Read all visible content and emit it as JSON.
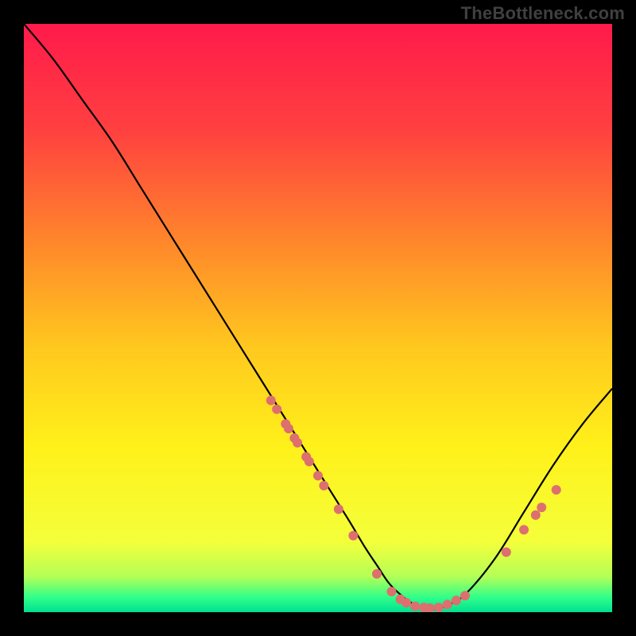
{
  "watermark": "TheBottleneck.com",
  "chart_data": {
    "type": "line",
    "title": "",
    "xlabel": "",
    "ylabel": "",
    "xlim": [
      0,
      100
    ],
    "ylim": [
      0,
      100
    ],
    "grid": false,
    "legend": false,
    "background_gradient_stops": [
      {
        "offset": 0.0,
        "color": "#ff1a4b"
      },
      {
        "offset": 0.18,
        "color": "#ff4040"
      },
      {
        "offset": 0.38,
        "color": "#ff8a2a"
      },
      {
        "offset": 0.55,
        "color": "#ffc81e"
      },
      {
        "offset": 0.72,
        "color": "#fff11a"
      },
      {
        "offset": 0.88,
        "color": "#f4ff3a"
      },
      {
        "offset": 0.94,
        "color": "#b3ff57"
      },
      {
        "offset": 0.975,
        "color": "#2fff8a"
      },
      {
        "offset": 1.0,
        "color": "#00e090"
      }
    ],
    "series": [
      {
        "name": "bottleneck-curve",
        "x": [
          0,
          5,
          10,
          15,
          20,
          25,
          30,
          35,
          40,
          45,
          50,
          55,
          58,
          60,
          62,
          64,
          66,
          68,
          70,
          72,
          75,
          80,
          85,
          90,
          95,
          100
        ],
        "y": [
          100,
          94,
          87,
          80,
          72,
          64,
          56,
          48,
          40,
          32,
          24,
          16,
          11,
          8,
          5,
          3,
          1.5,
          0.8,
          0.5,
          1.2,
          3,
          9,
          17,
          25,
          32,
          38
        ]
      }
    ],
    "markers": {
      "name": "dots",
      "type": "scatter",
      "color": "#dd6f6f",
      "radius": 6,
      "points": [
        {
          "x": 42,
          "y": 36
        },
        {
          "x": 43,
          "y": 34.5
        },
        {
          "x": 44.5,
          "y": 32
        },
        {
          "x": 45,
          "y": 31.2
        },
        {
          "x": 46,
          "y": 29.6
        },
        {
          "x": 46.5,
          "y": 28.8
        },
        {
          "x": 48,
          "y": 26.4
        },
        {
          "x": 48.5,
          "y": 25.6
        },
        {
          "x": 50,
          "y": 23.2
        },
        {
          "x": 51,
          "y": 21.5
        },
        {
          "x": 53.5,
          "y": 17.5
        },
        {
          "x": 56,
          "y": 13
        },
        {
          "x": 60,
          "y": 6.5
        },
        {
          "x": 62.5,
          "y": 3.5
        },
        {
          "x": 64,
          "y": 2.2
        },
        {
          "x": 65,
          "y": 1.6
        },
        {
          "x": 66.5,
          "y": 1.0
        },
        {
          "x": 68,
          "y": 0.8
        },
        {
          "x": 69,
          "y": 0.7
        },
        {
          "x": 70.5,
          "y": 0.8
        },
        {
          "x": 72,
          "y": 1.3
        },
        {
          "x": 73.5,
          "y": 2.0
        },
        {
          "x": 75,
          "y": 2.8
        },
        {
          "x": 82,
          "y": 10.2
        },
        {
          "x": 85,
          "y": 14.0
        },
        {
          "x": 87,
          "y": 16.5
        },
        {
          "x": 88,
          "y": 17.8
        },
        {
          "x": 90.5,
          "y": 20.8
        }
      ]
    }
  }
}
